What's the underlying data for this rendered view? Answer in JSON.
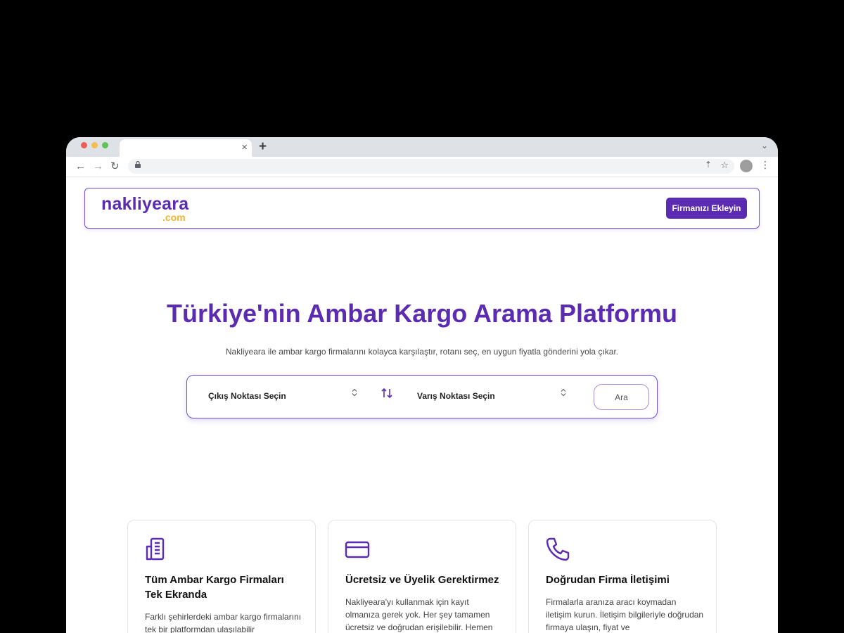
{
  "browser": {
    "tab_close": "×",
    "new_tab": "+",
    "tab_menu": "⌄",
    "back": "←",
    "forward": "→",
    "reload": "↻",
    "lock": "🔒",
    "share": "⇡",
    "star": "☆",
    "menu": "⋮"
  },
  "header": {
    "logo_main": "nakliyeara",
    "logo_sub": ".com",
    "cta_label": "Firmanızı Ekleyin",
    "brand_color": "#5b2bb1",
    "accent_color": "#f0b42b"
  },
  "hero": {
    "title": "Türkiye'nin Ambar Kargo Arama Platformu",
    "subtitle": "Nakliyeara ile ambar kargo firmalarını kolayca karşılaştır, rotanı seç, en uygun fiyatla gönderini yola çıkar."
  },
  "search": {
    "from_label": "Çıkış Noktası Seçin",
    "to_label": "Varış Noktası Seçin",
    "button_label": "Ara"
  },
  "features": [
    {
      "icon": "building-icon",
      "title": "Tüm Ambar Kargo Firmaları Tek Ekranda",
      "text": "Farklı şehirlerdeki ambar kargo firmalarını tek bir platformdan ulaşılabilir"
    },
    {
      "icon": "credit-card-icon",
      "title": "Ücretsiz ve Üyelik Gerektirmez",
      "text": "Nakliyeara'yı kullanmak için kayıt olmanıza gerek yok. Her şey tamamen ücretsiz ve doğrudan erişilebilir. Hemen"
    },
    {
      "icon": "phone-icon",
      "title": "Doğrudan Firma İletişimi",
      "text": "Firmalarla aranıza aracı koymadan iletişim kurun. İletişim bilgileriyle doğrudan firmaya ulaşın, fiyat ve"
    }
  ]
}
